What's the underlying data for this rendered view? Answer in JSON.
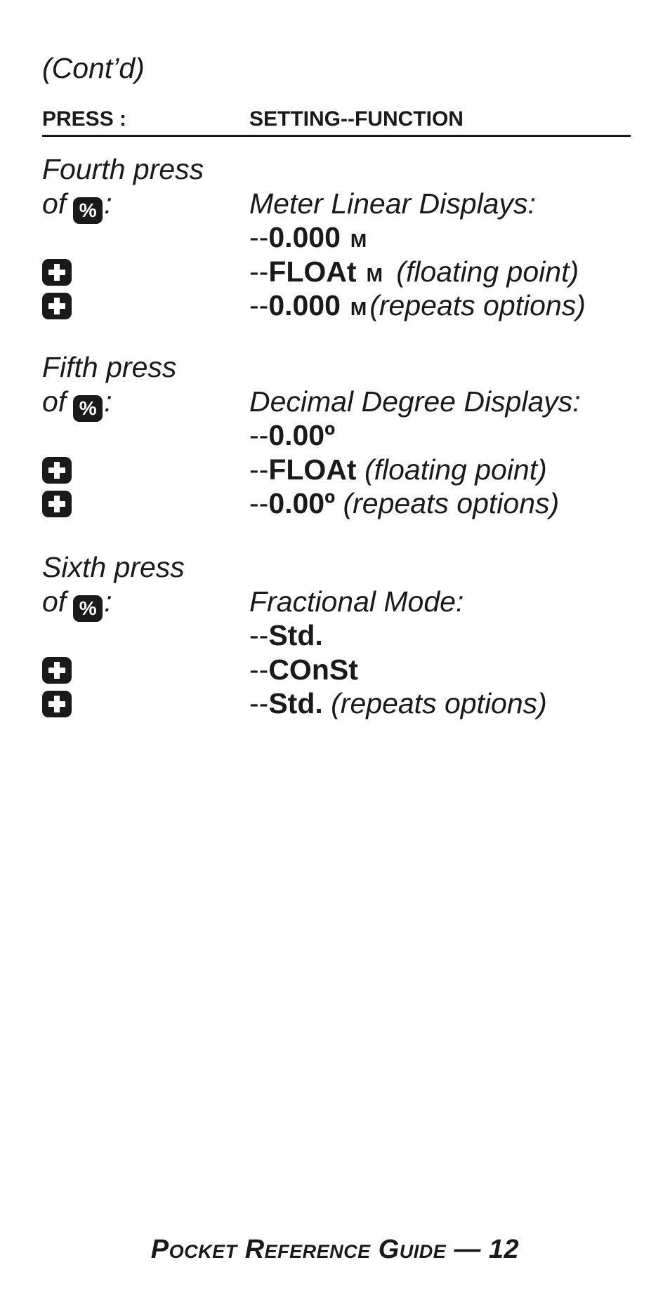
{
  "page": {
    "continued_label": "(Cont’d)",
    "header": {
      "press": "PRESS :",
      "setting": "SETTING--FUNCTION"
    },
    "icons": {
      "percent_key": "%",
      "plus_key": "+"
    },
    "sections": [
      {
        "press_line1": "Fourth press",
        "press_of": "of",
        "press_colon": ":",
        "title": "Meter Linear Displays:",
        "options": [
          {
            "key": "",
            "prefix": "--",
            "value": "0.000",
            "unit": "M",
            "note": ""
          },
          {
            "key": "+",
            "prefix": "--",
            "value": "FLOAt",
            "unit": "M",
            "note": "(floating point)"
          },
          {
            "key": "+",
            "prefix": "--",
            "value": "0.000",
            "unit": "M",
            "note": "(repeats options)"
          }
        ]
      },
      {
        "press_line1": "Fifth press",
        "press_of": "of",
        "press_colon": ":",
        "title": "Decimal Degree Displays:",
        "options": [
          {
            "key": "",
            "prefix": "--",
            "value": "0.00º",
            "unit": "",
            "note": ""
          },
          {
            "key": "+",
            "prefix": "--",
            "value": "FLOAt",
            "unit": "",
            "note": "(floating point)"
          },
          {
            "key": "+",
            "prefix": "--",
            "value": "0.00º",
            "unit": "",
            "note": "(repeats options)"
          }
        ]
      },
      {
        "press_line1": "Sixth press",
        "press_of": "of",
        "press_colon": ":",
        "title": "Fractional Mode:",
        "options": [
          {
            "key": "",
            "prefix": "--",
            "value": "Std.",
            "unit": "",
            "note": ""
          },
          {
            "key": "+",
            "prefix": "--",
            "value": "COnSt",
            "unit": "",
            "note": ""
          },
          {
            "key": "+",
            "prefix": "--",
            "value": "Std.",
            "unit": "",
            "note": "(repeats options)"
          }
        ]
      }
    ],
    "footer": {
      "title": "Pocket Reference Guide",
      "separator": "—",
      "page_number": "12"
    }
  }
}
